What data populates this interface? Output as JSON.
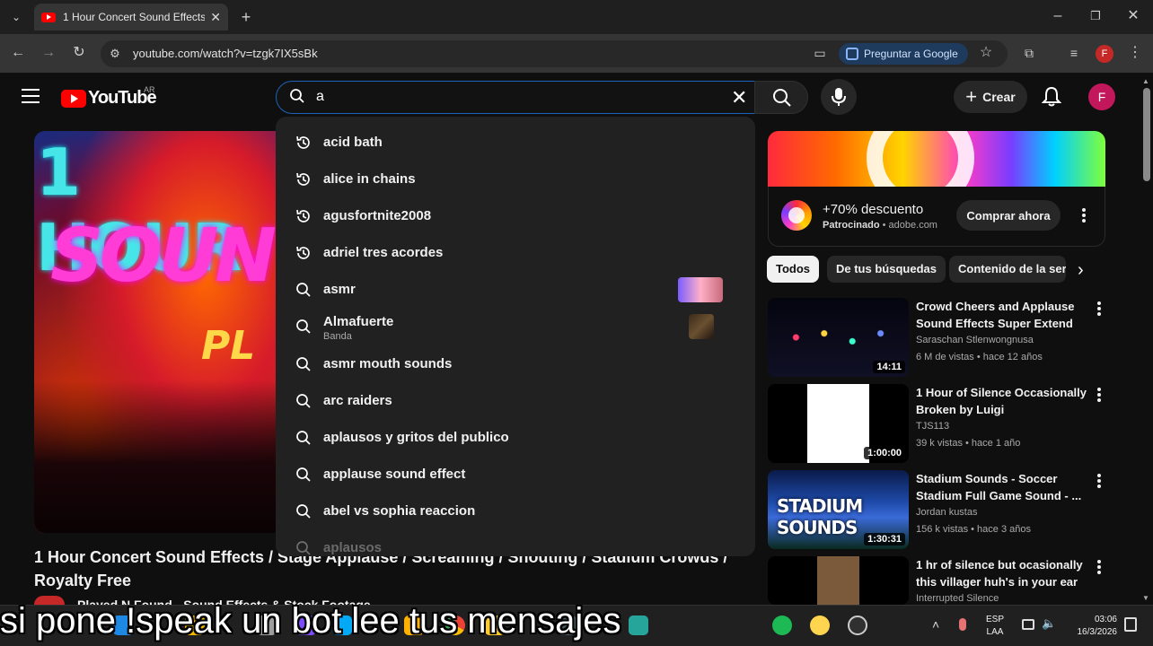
{
  "browser": {
    "tab_title": "1 Hour Concert Sound Effects /",
    "url": "youtube.com/watch?v=tzgk7IX5sBk",
    "google_button": "Preguntar a Google",
    "profile_initial": "F"
  },
  "header": {
    "logo_text": "YouTube",
    "region": "AR",
    "search_query": "a",
    "create_label": "Crear",
    "avatar_initial": "F"
  },
  "suggestions": [
    {
      "text": "acid bath",
      "icon": "history-icon"
    },
    {
      "text": "alice in chains",
      "icon": "history-icon"
    },
    {
      "text": "agusfortnite2008",
      "icon": "history-icon"
    },
    {
      "text": "adriel tres acordes",
      "icon": "history-icon"
    },
    {
      "text": "asmr",
      "icon": "search-icon"
    },
    {
      "text": "Almafuerte",
      "sub": "Banda",
      "icon": "search-icon"
    },
    {
      "text": "asmr mouth sounds",
      "icon": "search-icon"
    },
    {
      "text": "arc raiders",
      "icon": "search-icon"
    },
    {
      "text": "aplausos y gritos del publico",
      "icon": "search-icon"
    },
    {
      "text": "applause sound effect",
      "icon": "search-icon"
    },
    {
      "text": "abel vs sophia reaccion",
      "icon": "search-icon"
    },
    {
      "text": "aplausos",
      "icon": "search-icon"
    }
  ],
  "video": {
    "thumb_line1": "1 HOUR",
    "thumb_line2": "SOUN",
    "thumb_line3": "PL",
    "title": "1 Hour Concert Sound Effects / Stage Applause / Screaming / Shouting / Stadium Crowds / Royalty Free",
    "channel": "Played N Found - Sound Effects & Stock Footage"
  },
  "ad": {
    "title": "+70% descuento",
    "sponsored": "Patrocinado",
    "domain": "adobe.com",
    "cta": "Comprar ahora"
  },
  "chips": [
    "Todos",
    "De tus búsquedas",
    "Contenido de la ser"
  ],
  "related": [
    {
      "title": "Crowd Cheers and Applause Sound Effects Super Extend",
      "channel": "Saraschan Stlenwongnusa",
      "meta": "6 M de vistas • hace 12 años",
      "duration": "14:11"
    },
    {
      "title": "1 Hour of Silence Occasionally Broken by Luigi",
      "channel": "TJS113",
      "meta": "39 k vistas • hace 1 año",
      "duration": "1:00:00"
    },
    {
      "title": "Stadium Sounds - Soccer Stadium Full Game Sound - ...",
      "channel": "Jordan kustas",
      "meta": "156 k vistas • hace 3 años",
      "duration": "1:30:31",
      "thumb_text": "STADIUM SOUNDS"
    },
    {
      "title": "1 hr of silence but ocasionally this villager huh's in your ear ...",
      "channel": "Interrupted Silence",
      "meta": "",
      "duration": ""
    }
  ],
  "caption": "si pone !speak un bot lee tus mensajes",
  "taskbar": {
    "lang_line1": "ESP",
    "lang_line2": "LAA",
    "time": "03:06",
    "date": "16/3/2026"
  },
  "colors": {
    "background": "#0f0f0f",
    "youtube_red": "#ff0000",
    "search_border": "#1c62b9",
    "avatar": "#c2185b"
  }
}
